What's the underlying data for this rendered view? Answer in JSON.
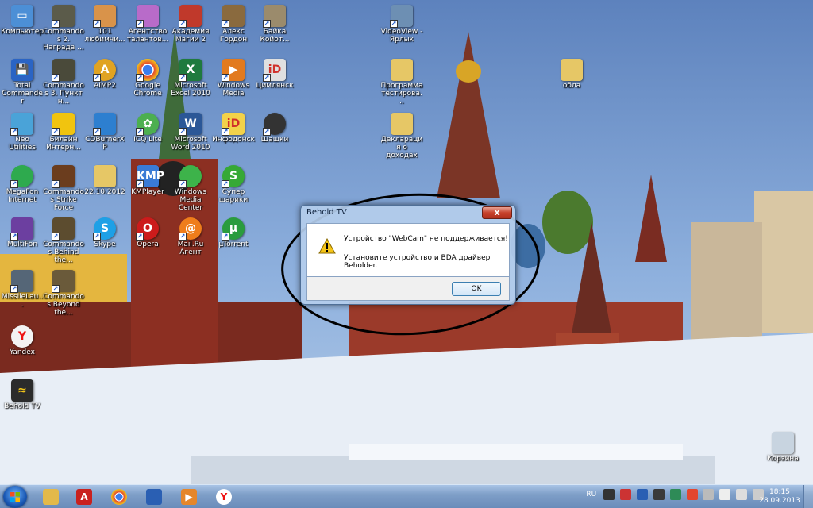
{
  "desktop": {
    "icons": [
      {
        "label": "Компьютер",
        "icon": "computer-icon",
        "color": "#4c8fd6"
      },
      {
        "label": "Commandos 2. Награда ...",
        "icon": "commandos2-icon",
        "color": "#5b5b4a"
      },
      {
        "label": "101 любимчи...",
        "icon": "101-pets-icon",
        "color": "#d9934a"
      },
      {
        "label": "Агентство талантов...",
        "icon": "talent-agency-icon",
        "color": "#b86bc9"
      },
      {
        "label": "Академия Магии 2",
        "icon": "magic-academy-icon",
        "color": "#c0392b"
      },
      {
        "label": "Алекс Гордон",
        "icon": "alex-gordon-icon",
        "color": "#8a6a3e"
      },
      {
        "label": "Байка Койот...",
        "icon": "coyote-icon",
        "color": "#9b8b6c"
      },
      {
        "label": "VideoView - Ярлык",
        "icon": "videoview-icon",
        "color": "#6d8fb3"
      },
      {
        "label": "Total Commander",
        "icon": "total-commander-icon",
        "color": "#2a64c4"
      },
      {
        "label": "Commandos 3. Пункт н...",
        "icon": "commandos3-icon",
        "color": "#4a4a3a"
      },
      {
        "label": "AIMP2",
        "icon": "aimp-icon",
        "color": "#e0a322"
      },
      {
        "label": "Google Chrome",
        "icon": "chrome-icon",
        "color": "#e3462f"
      },
      {
        "label": "Microsoft Excel 2010",
        "icon": "excel-icon",
        "color": "#1f7a3e"
      },
      {
        "label": "Windows Media",
        "icon": "windows-media-icon",
        "color": "#e27a1e"
      },
      {
        "label": "Цимлянск",
        "icon": "tsimlyansk-icon",
        "color": "#e0e0e0"
      },
      {
        "label": "Программа тестирова...",
        "icon": "folder-icon",
        "color": "#e6c766"
      },
      {
        "label": "обла",
        "icon": "folder-icon",
        "color": "#e6c766"
      },
      {
        "label": "Neo Utilities",
        "icon": "neo-utilities-icon",
        "color": "#4aa3d8"
      },
      {
        "label": "Билайн Интерн...",
        "icon": "beeline-icon",
        "color": "#f1c40f"
      },
      {
        "label": "CDBurnerXP",
        "icon": "cdburner-icon",
        "color": "#2d7fd0"
      },
      {
        "label": "ICQ Lite",
        "icon": "icq-icon",
        "color": "#4caf50"
      },
      {
        "label": "Microsoft Word 2010",
        "icon": "word-icon",
        "color": "#2b5797"
      },
      {
        "label": "Инфодонск",
        "icon": "infodonsk-icon",
        "color": "#f3d24a"
      },
      {
        "label": "Шашки",
        "icon": "checkers-icon",
        "color": "#333333"
      },
      {
        "label": "Декларация о доходах",
        "icon": "folder-icon",
        "color": "#e6c766"
      },
      {
        "label": "MegaFon Internet",
        "icon": "megafon-icon",
        "color": "#2eaa4e"
      },
      {
        "label": "Commandos Strike Force",
        "icon": "commandos-sf-icon",
        "color": "#6b3d1e"
      },
      {
        "label": "22.10.2012",
        "icon": "folder-icon",
        "color": "#e6c766"
      },
      {
        "label": "KMPlayer",
        "icon": "kmplayer-icon",
        "color": "#3a7bd5"
      },
      {
        "label": "Windows Media Center",
        "icon": "media-center-icon",
        "color": "#3db34a"
      },
      {
        "label": "Супер шарики",
        "icon": "super-balls-icon",
        "color": "#36a936"
      },
      {
        "label": "MultiFon",
        "icon": "multifon-icon",
        "color": "#6c3fa0"
      },
      {
        "label": "Commandos Behind the...",
        "icon": "commandos-bel-icon",
        "color": "#5c4c2f"
      },
      {
        "label": "Skype",
        "icon": "skype-icon",
        "color": "#1ea0e6"
      },
      {
        "label": "Opera",
        "icon": "opera-icon",
        "color": "#cc1b1b"
      },
      {
        "label": "Mail.Ru Агент",
        "icon": "mailru-agent-icon",
        "color": "#ef7d1b"
      },
      {
        "label": "µTorrent",
        "icon": "utorrent-icon",
        "color": "#2a9c3e"
      },
      {
        "label": "MissileLau...",
        "icon": "missile-launcher-icon",
        "color": "#556677"
      },
      {
        "label": "Commandos Beyond the...",
        "icon": "commandos-beyond-icon",
        "color": "#6a5a3a"
      },
      {
        "label": "Yandex",
        "icon": "yandex-icon",
        "color": "#f3f3f3"
      },
      {
        "label": "Behold TV",
        "icon": "behold-tv-icon",
        "color": "#2b2b2b"
      },
      {
        "label": "Корзина",
        "icon": "recycle-bin-icon",
        "color": "#c8d4e0"
      }
    ]
  },
  "dialog": {
    "title": "Behold TV",
    "close_label": "x",
    "message_line1": "Устройство \"WebCam\" не поддерживается!",
    "message_line2": "Установите устройство и BDA драйвер Beholder.",
    "ok_label": "OK"
  },
  "taskbar": {
    "pinned": [
      {
        "name": "taskbar-explorer",
        "icon": "folder-icon",
        "color": "#e3b94a",
        "glyph": ""
      },
      {
        "name": "taskbar-acrobat",
        "icon": "acrobat-icon",
        "color": "#c9211e",
        "glyph": "A"
      },
      {
        "name": "taskbar-chrome",
        "icon": "chrome-icon",
        "color": "#e3462f",
        "glyph": ""
      },
      {
        "name": "taskbar-save",
        "icon": "floppy-icon",
        "color": "#2a5fb3",
        "glyph": ""
      },
      {
        "name": "taskbar-media-player",
        "icon": "media-player-icon",
        "color": "#e5862a",
        "glyph": "▶"
      },
      {
        "name": "taskbar-yandex",
        "icon": "yandex-icon",
        "color": "#ffffff",
        "glyph": "Y"
      }
    ],
    "language": "RU",
    "time": "18:15",
    "date": "28.09.2013"
  }
}
